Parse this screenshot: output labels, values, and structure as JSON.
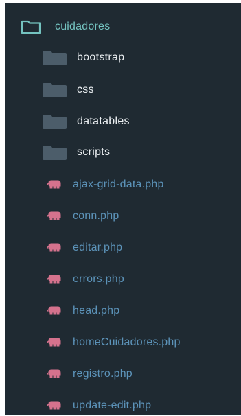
{
  "explorer": {
    "root": {
      "label": "cuidadores",
      "icon": "folder-open-outline-icon"
    },
    "folders": [
      {
        "label": "bootstrap",
        "icon": "folder-icon"
      },
      {
        "label": "css",
        "icon": "folder-icon"
      },
      {
        "label": "datatables",
        "icon": "folder-icon"
      },
      {
        "label": "scripts",
        "icon": "folder-icon"
      }
    ],
    "files": [
      {
        "label": "ajax-grid-data.php",
        "icon": "php-elephant-icon"
      },
      {
        "label": "conn.php",
        "icon": "php-elephant-icon"
      },
      {
        "label": "editar.php",
        "icon": "php-elephant-icon"
      },
      {
        "label": "errors.php",
        "icon": "php-elephant-icon"
      },
      {
        "label": "head.php",
        "icon": "php-elephant-icon"
      },
      {
        "label": "homeCuidadores.php",
        "icon": "php-elephant-icon"
      },
      {
        "label": "registro.php",
        "icon": "php-elephant-icon"
      },
      {
        "label": "update-edit.php",
        "icon": "php-elephant-icon"
      }
    ]
  },
  "colors": {
    "panel_background": "#1f2a32",
    "root_label": "#74c3c0",
    "folder_label": "#e9edf0",
    "folder_icon": "#4c5d6a",
    "file_label": "#5c93b9",
    "php_icon": "#d5728d"
  }
}
